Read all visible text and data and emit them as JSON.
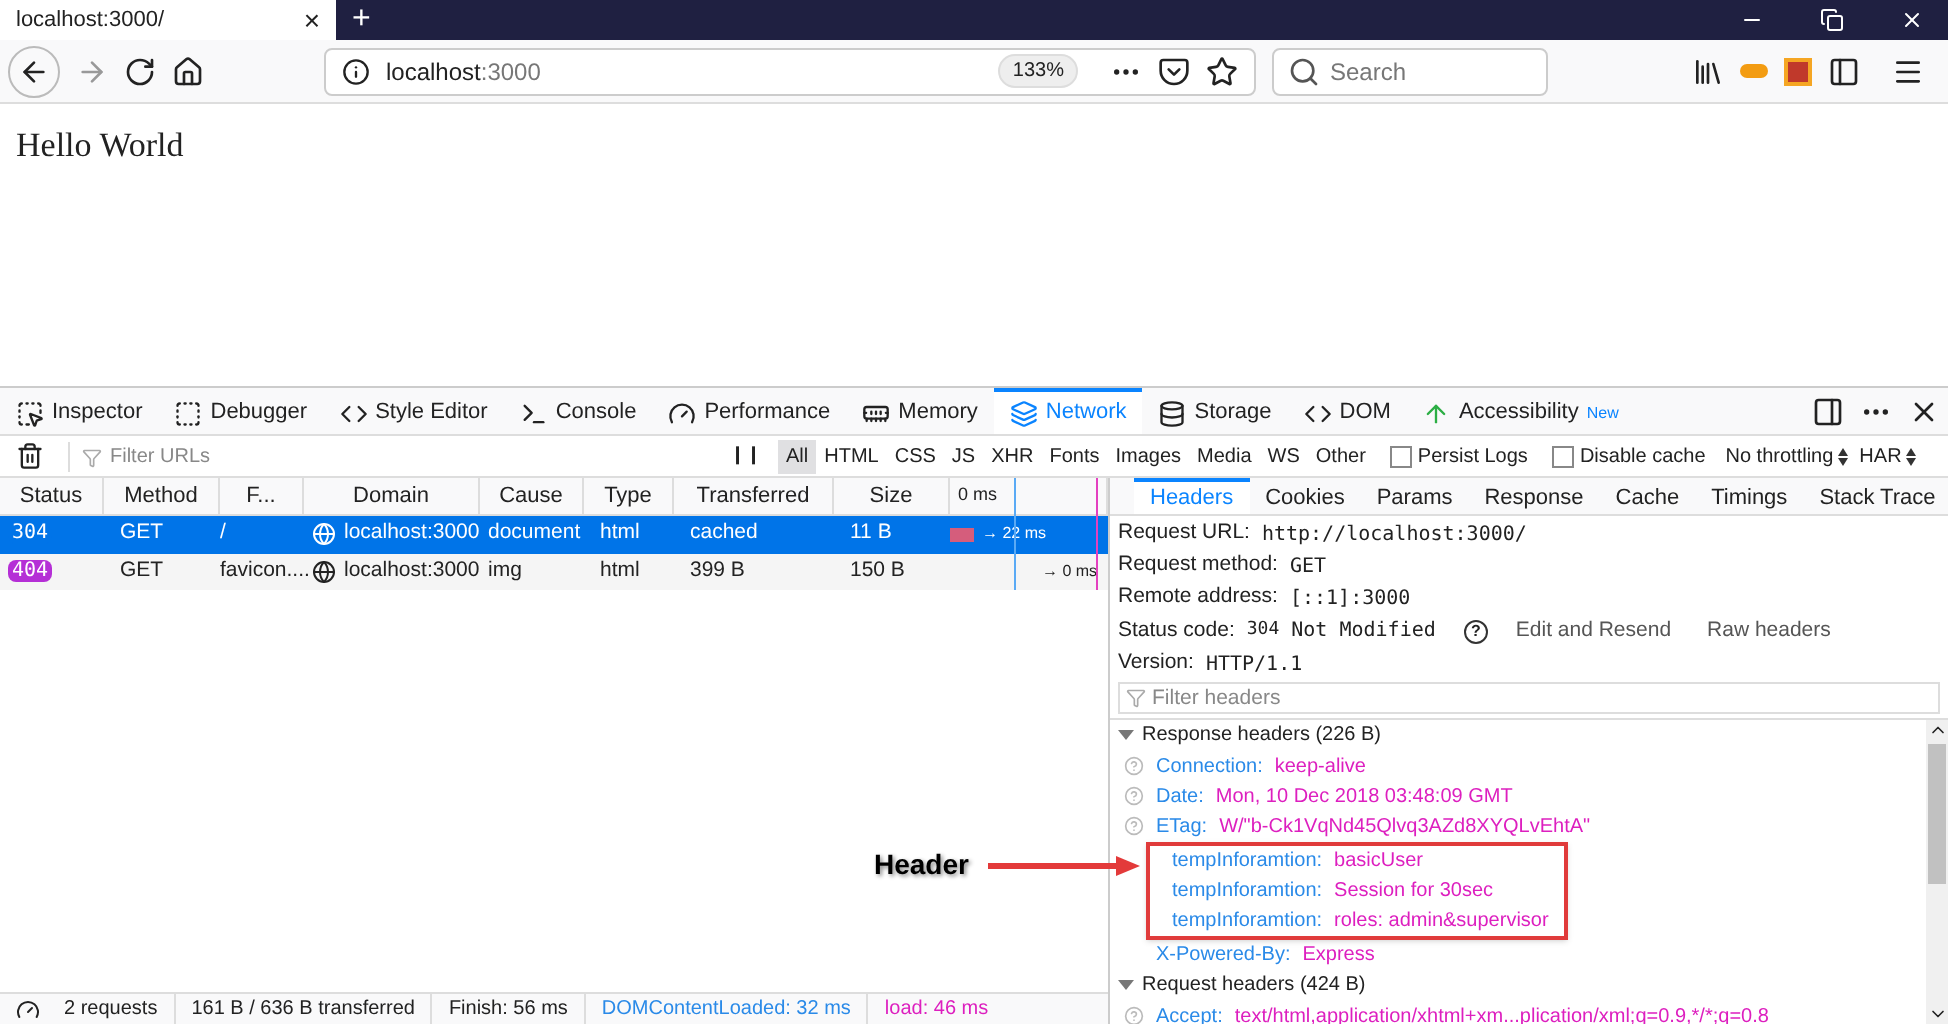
{
  "browser": {
    "tab_title": "localhost:3000/",
    "tab_close": "×",
    "new_tab": "+",
    "url_host": "localhost",
    "url_port": ":3000",
    "zoom": "133%",
    "search_placeholder": "Search"
  },
  "page": {
    "text": "Hello World"
  },
  "devtools": {
    "tabs": [
      {
        "label": "Inspector",
        "selected": false
      },
      {
        "label": "Debugger",
        "selected": false
      },
      {
        "label": "Style Editor",
        "selected": false
      },
      {
        "label": "Console",
        "selected": false
      },
      {
        "label": "Performance",
        "selected": false
      },
      {
        "label": "Memory",
        "selected": false
      },
      {
        "label": "Network",
        "selected": true
      },
      {
        "label": "Storage",
        "selected": false
      },
      {
        "label": "DOM",
        "selected": false
      },
      {
        "label": "Accessibility",
        "selected": false,
        "badge": "New"
      }
    ],
    "filter_placeholder": "Filter URLs",
    "pause": "❙❙",
    "type_filters": [
      {
        "label": "All",
        "selected": true
      },
      {
        "label": "HTML",
        "selected": false
      },
      {
        "label": "CSS",
        "selected": false
      },
      {
        "label": "JS",
        "selected": false
      },
      {
        "label": "XHR",
        "selected": false
      },
      {
        "label": "Fonts",
        "selected": false
      },
      {
        "label": "Images",
        "selected": false
      },
      {
        "label": "Media",
        "selected": false
      },
      {
        "label": "WS",
        "selected": false
      },
      {
        "label": "Other",
        "selected": false
      }
    ],
    "options": [
      {
        "label": "Persist Logs",
        "checked": false
      },
      {
        "label": "Disable cache",
        "checked": false
      }
    ],
    "selects": [
      "No throttling",
      "HAR"
    ],
    "columns": [
      "Status",
      "Method",
      "F...",
      "Domain",
      "Cause",
      "Type",
      "Transferred",
      "Size",
      "0 ms"
    ],
    "requests": [
      {
        "status": "304",
        "color": "#0074e8",
        "method": "GET",
        "file": "/",
        "domain": "localhost:3000",
        "cause": "document",
        "type": "html",
        "transferred": "cached",
        "size": "11 B",
        "timing": "→ 22 ms",
        "selected": true
      },
      {
        "status": "404",
        "color": "#b52fd6",
        "method": "GET",
        "file": "favicon....",
        "domain": "localhost:3000",
        "cause": "img",
        "type": "html",
        "transferred": "399 B",
        "size": "150 B",
        "timing": "→ 0 ms",
        "selected": false
      }
    ],
    "detail_tabs": [
      {
        "label": "Headers",
        "selected": true
      },
      {
        "label": "Cookies",
        "selected": false
      },
      {
        "label": "Params",
        "selected": false
      },
      {
        "label": "Response",
        "selected": false
      },
      {
        "label": "Cache",
        "selected": false
      },
      {
        "label": "Timings",
        "selected": false
      },
      {
        "label": "Stack Trace",
        "selected": false
      }
    ],
    "summary": [
      {
        "label": "Request URL:",
        "value": "http://localhost:3000/"
      },
      {
        "label": "Request method:",
        "value": "GET"
      },
      {
        "label": "Remote address:",
        "value": "[::1]:3000"
      }
    ],
    "status_code": {
      "label": "Status code:",
      "code": "304",
      "text": "Not Modified",
      "help": "?",
      "edit": "Edit and Resend",
      "raw": "Raw headers"
    },
    "version": {
      "label": "Version:",
      "value": "HTTP/1.1"
    },
    "header_filter_placeholder": "Filter headers",
    "sections": [
      {
        "title": "Response headers (226 B)",
        "expanded": true,
        "headers": [
          {
            "name": "Connection:",
            "value": "keep-alive",
            "help": true,
            "highlighted": false
          },
          {
            "name": "Date:",
            "value": "Mon, 10 Dec 2018 03:48:09 GMT",
            "help": true,
            "highlighted": false
          },
          {
            "name": "ETag:",
            "value": "W/\"b-Ck1VqNd45Qlvq3AZd8XYQLvEhtA\"",
            "help": true,
            "highlighted": false
          },
          {
            "name": "tempInforamtion:",
            "value": "basicUser",
            "help": false,
            "highlighted": true
          },
          {
            "name": "tempInforamtion:",
            "value": "Session for 30sec",
            "help": false,
            "highlighted": true
          },
          {
            "name": "tempInforamtion:",
            "value": "roles: admin&supervisor",
            "help": false,
            "highlighted": true
          },
          {
            "name": "X-Powered-By:",
            "value": "Express",
            "help": false,
            "highlighted": false
          }
        ]
      },
      {
        "title": "Request headers (424 B)",
        "expanded": true,
        "headers": [
          {
            "name": "Accept:",
            "value": "text/html,application/xhtml+xm...plication/xml;q=0.9,*/*;q=0.8",
            "help": true,
            "highlighted": false
          }
        ]
      }
    ],
    "status_bar": {
      "requests": "2 requests",
      "transferred": "161 B / 636 B transferred",
      "finish": "Finish: 56 ms",
      "dom_loaded": "DOMContentLoaded: 32 ms",
      "load": "load: 46 ms"
    }
  },
  "annotation": {
    "label": "Header"
  }
}
